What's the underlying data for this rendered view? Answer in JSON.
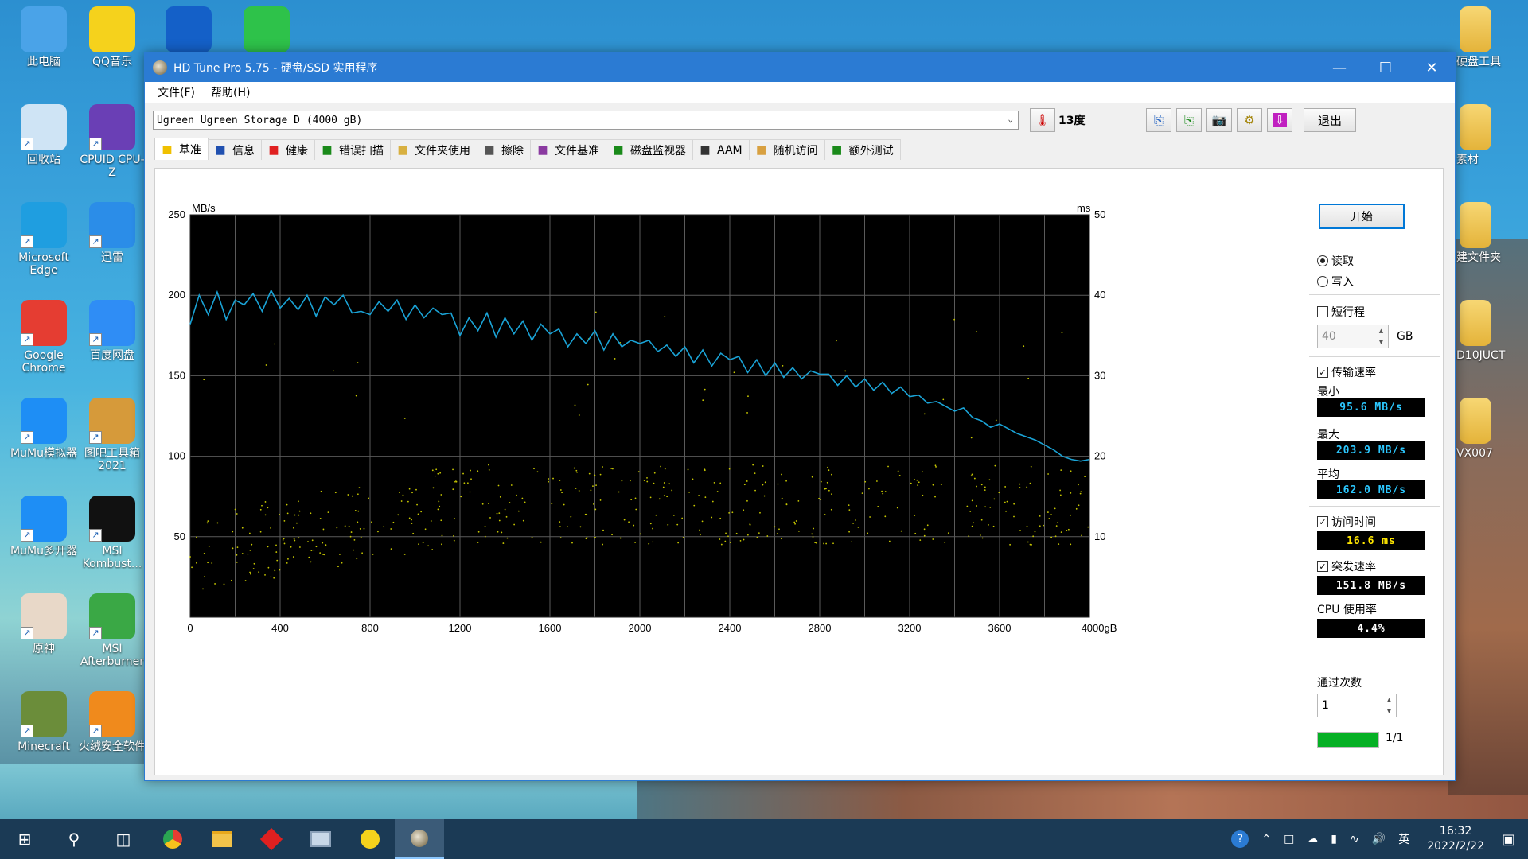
{
  "desktop": {
    "left_icons": [
      {
        "label": "此电脑",
        "icon": "computer-icon",
        "color": "#4aa3e8"
      },
      {
        "label": "QQ音乐",
        "icon": "qq-music-icon",
        "color": "#f5d21c"
      },
      {
        "label": "回收站",
        "icon": "recycle-bin-icon",
        "color": "#cfe4f5"
      },
      {
        "label": "CPUID CPU-Z",
        "icon": "cpuz-icon",
        "color": "#6a3fb5"
      },
      {
        "label": "Microsoft Edge",
        "icon": "edge-icon",
        "color": "#1f9ee0"
      },
      {
        "label": "迅雷",
        "icon": "xunlei-icon",
        "color": "#2b8de8"
      },
      {
        "label": "Google Chrome",
        "icon": "chrome-icon",
        "color": "#e53d32"
      },
      {
        "label": "百度网盘",
        "icon": "baidu-netdisk-icon",
        "color": "#2f8df5"
      },
      {
        "label": "MuMu模拟器",
        "icon": "mumu-icon",
        "color": "#1e8ef5"
      },
      {
        "label": "图吧工具箱2021",
        "icon": "toolbox-icon",
        "color": "#d69a3a"
      },
      {
        "label": "MuMu多开器",
        "icon": "mumu-multi-icon",
        "color": "#1e8ef5"
      },
      {
        "label": "MSI Kombust...",
        "icon": "msi-kombustor-icon",
        "color": "#111111"
      },
      {
        "label": "原神",
        "icon": "genshin-icon",
        "color": "#e8d8c8"
      },
      {
        "label": "MSI Afterburner",
        "icon": "msi-afterburner-icon",
        "color": "#3aa845"
      },
      {
        "label": "Minecraft",
        "icon": "minecraft-icon",
        "color": "#6b8d3a"
      },
      {
        "label": "火绒安全软件",
        "icon": "huorong-icon",
        "color": "#f08a1c"
      }
    ],
    "top_icons": [
      {
        "label": "",
        "icon": "wd-icon",
        "color": "#1460c8"
      },
      {
        "label": "",
        "icon": "wechat-icon",
        "color": "#2ec24a"
      }
    ],
    "right_icons": [
      {
        "label": "硬盘工具",
        "icon": "folder-icon"
      },
      {
        "label": "素材",
        "icon": "folder-icon"
      },
      {
        "label": "建文件夹",
        "icon": "folder-icon"
      },
      {
        "label": "D10JUCT",
        "icon": "folder-icon"
      },
      {
        "label": "VX007",
        "icon": "folder-icon"
      }
    ]
  },
  "window": {
    "title": "HD Tune Pro 5.75 - 硬盘/SSD 实用程序",
    "menu": [
      "文件(F)",
      "帮助(H)"
    ],
    "drive": "Ugreen  Ugreen Storage D (4000 gB)",
    "temperature": "13度",
    "exit_label": "退出",
    "toolbar_icons": [
      "copy-text-icon",
      "copy-info-icon",
      "screenshot-icon",
      "options-icon",
      "save-icon"
    ],
    "tabs": [
      {
        "label": "基准",
        "icon": "benchmark-icon",
        "color": "#f0c000",
        "active": true
      },
      {
        "label": "信息",
        "icon": "info-icon",
        "color": "#2050b0"
      },
      {
        "label": "健康",
        "icon": "health-icon",
        "color": "#e02020"
      },
      {
        "label": "错误扫描",
        "icon": "error-scan-icon",
        "color": "#1a8a1a"
      },
      {
        "label": "文件夹使用",
        "icon": "folder-usage-icon",
        "color": "#d8b040"
      },
      {
        "label": "擦除",
        "icon": "erase-icon",
        "color": "#555555"
      },
      {
        "label": "文件基准",
        "icon": "file-benchmark-icon",
        "color": "#8a3aa0"
      },
      {
        "label": "磁盘监视器",
        "icon": "disk-monitor-icon",
        "color": "#1a8a1a"
      },
      {
        "label": "AAM",
        "icon": "aam-icon",
        "color": "#333333"
      },
      {
        "label": "随机访问",
        "icon": "random-access-icon",
        "color": "#d8a040"
      },
      {
        "label": "额外测试",
        "icon": "extra-tests-icon",
        "color": "#1a8a1a"
      }
    ]
  },
  "side": {
    "start_label": "开始",
    "mode_options": [
      {
        "label": "读取",
        "selected": true
      },
      {
        "label": "写入",
        "selected": false
      }
    ],
    "short_stroke": {
      "label": "短行程",
      "checked": false,
      "value": "40",
      "unit": "GB"
    },
    "transfer_rate": {
      "label": "传输速率",
      "checked": true
    },
    "min_label": "最小",
    "min_value": "95.6 MB/s",
    "max_label": "最大",
    "max_value": "203.9 MB/s",
    "avg_label": "平均",
    "avg_value": "162.0 MB/s",
    "access_time": {
      "label": "访问时间",
      "checked": true,
      "value": "16.6 ms"
    },
    "burst_rate": {
      "label": "突发速率",
      "checked": true,
      "value": "151.8 MB/s"
    },
    "cpu_label": "CPU 使用率",
    "cpu_value": "4.4%",
    "passes_label": "通过次数",
    "passes_value": "1",
    "progress_text": "1/1",
    "progress_fraction": 1.0
  },
  "chart_data": {
    "type": "line",
    "title": "",
    "ylabel_left": "MB/s",
    "ylabel_right": "ms",
    "xlabel": "",
    "xlim": [
      0,
      4000
    ],
    "ylim_left": [
      0,
      250
    ],
    "ylim_right": [
      0,
      50
    ],
    "x_ticks": [
      "0",
      "400",
      "800",
      "1200",
      "1600",
      "2000",
      "2400",
      "2800",
      "3200",
      "3600",
      "4000gB"
    ],
    "y_ticks_left": [
      "50",
      "100",
      "150",
      "200",
      "250"
    ],
    "y_ticks_right": [
      "10",
      "20",
      "30",
      "40",
      "50"
    ],
    "grid": true,
    "background": "#000000",
    "series": [
      {
        "name": "",
        "color": "#1aa3d6",
        "x": [
          0,
          40,
          80,
          120,
          160,
          200,
          240,
          280,
          320,
          360,
          400,
          440,
          480,
          520,
          560,
          600,
          640,
          680,
          720,
          760,
          800,
          840,
          880,
          920,
          960,
          1000,
          1040,
          1080,
          1120,
          1160,
          1200,
          1240,
          1280,
          1320,
          1360,
          1400,
          1440,
          1480,
          1520,
          1560,
          1600,
          1640,
          1680,
          1720,
          1760,
          1800,
          1840,
          1880,
          1920,
          1960,
          2000,
          2040,
          2080,
          2120,
          2160,
          2200,
          2240,
          2280,
          2320,
          2360,
          2400,
          2440,
          2480,
          2520,
          2560,
          2600,
          2640,
          2680,
          2720,
          2760,
          2800,
          2840,
          2880,
          2920,
          2960,
          3000,
          3040,
          3080,
          3120,
          3160,
          3200,
          3240,
          3280,
          3320,
          3360,
          3400,
          3440,
          3480,
          3520,
          3560,
          3600,
          3640,
          3680,
          3720,
          3760,
          3800,
          3840,
          3880,
          3920,
          3960,
          4000
        ],
        "values": [
          182,
          200,
          188,
          202,
          185,
          197,
          194,
          201,
          190,
          203,
          192,
          198,
          191,
          200,
          187,
          199,
          194,
          200,
          189,
          190,
          188,
          196,
          190,
          197,
          185,
          194,
          186,
          192,
          188,
          189,
          175,
          186,
          178,
          189,
          174,
          186,
          176,
          184,
          172,
          182,
          176,
          179,
          168,
          176,
          170,
          178,
          166,
          176,
          168,
          172,
          170,
          172,
          165,
          169,
          162,
          168,
          158,
          166,
          156,
          164,
          160,
          162,
          152,
          160,
          150,
          158,
          149,
          155,
          148,
          153,
          151,
          151,
          144,
          150,
          143,
          148,
          141,
          146,
          139,
          143,
          137,
          138,
          133,
          134,
          131,
          128,
          130,
          124,
          122,
          118,
          120,
          117,
          114,
          112,
          110,
          107,
          104,
          100,
          98,
          97,
          98
        ]
      }
    ],
    "scatter": {
      "name": "",
      "color": "#c8c800",
      "axis": "right",
      "summary_ms": 16.6
    }
  },
  "taskbar": {
    "items": [
      "start-icon",
      "search-icon",
      "task-view-icon",
      "chrome-icon",
      "file-explorer-icon",
      "app-red-icon",
      "screenshot-app-icon",
      "qq-music-icon",
      "hdtune-icon"
    ],
    "tray_lang": "英",
    "time": "16:32",
    "date": "2022/2/22"
  }
}
